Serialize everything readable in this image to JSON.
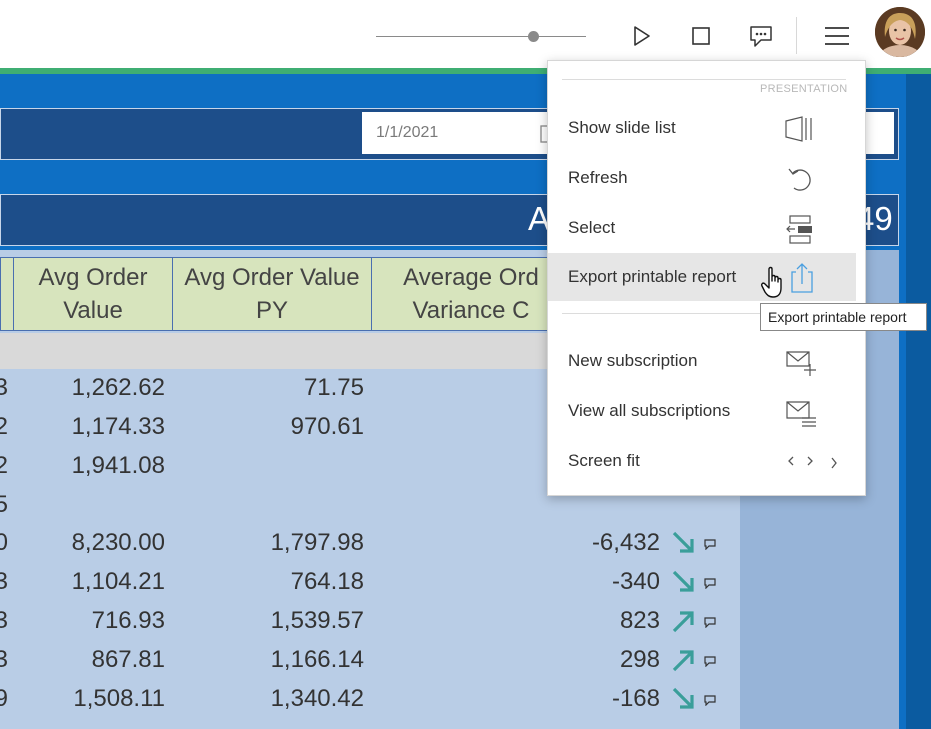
{
  "toolbar": {
    "zoom_slider_level": 0.72,
    "icons": [
      "play-icon",
      "stop-icon",
      "comment-icon",
      "menu-icon"
    ]
  },
  "filter": {
    "date_value": "1/1/2021"
  },
  "header": {
    "big_left": "A",
    "big_right": "49"
  },
  "table": {
    "columns": [
      "Avg Order\nValue",
      "Avg Order Value\nPY",
      "Average Ord\nVariance C"
    ],
    "rows": [
      {
        "c0": "3",
        "aov": "1,262.62",
        "aov_py": "71.75",
        "variance": "",
        "trend": ""
      },
      {
        "c0": "2",
        "aov": "1,174.33",
        "aov_py": "970.61",
        "variance": "",
        "trend": ""
      },
      {
        "c0": "2",
        "aov": "1,941.08",
        "aov_py": "",
        "variance": "",
        "trend": ""
      },
      {
        "c0": "5",
        "aov": "",
        "aov_py": "",
        "variance": "",
        "trend": ""
      },
      {
        "c0": "0",
        "aov": "8,230.00",
        "aov_py": "1,797.98",
        "variance": "-6,432",
        "trend": "down"
      },
      {
        "c0": "3",
        "aov": "1,104.21",
        "aov_py": "764.18",
        "variance": "-340",
        "trend": "down"
      },
      {
        "c0": "3",
        "aov": "716.93",
        "aov_py": "1,539.57",
        "variance": "823",
        "trend": "up"
      },
      {
        "c0": "3",
        "aov": "867.81",
        "aov_py": "1,166.14",
        "variance": "298",
        "trend": "up"
      },
      {
        "c0": "9",
        "aov": "1,508.11",
        "aov_py": "1,340.42",
        "variance": "-168",
        "trend": "down"
      }
    ]
  },
  "menu": {
    "section_label": "PRESENTATION",
    "items": [
      {
        "label": "Show slide list",
        "icon": "slide-list-icon"
      },
      {
        "label": "Refresh",
        "icon": "refresh-icon"
      },
      {
        "label": "Select",
        "icon": "select-icon"
      },
      {
        "label": "Export printable report",
        "icon": "export-icon"
      },
      {
        "label": "New subscription",
        "icon": "new-subscription-icon"
      },
      {
        "label": "View all subscriptions",
        "icon": "view-subscriptions-icon"
      },
      {
        "label": "Screen fit",
        "icon": "screen-fit-icon"
      }
    ]
  },
  "tooltip": {
    "text": "Export printable report"
  },
  "colors": {
    "report_blue": "#0e6fc4",
    "band_navy": "#1d4e8a",
    "header_green": "#d7e4bd",
    "arrow_teal": "#3a9e9a",
    "accent_green": "#3fae73"
  }
}
